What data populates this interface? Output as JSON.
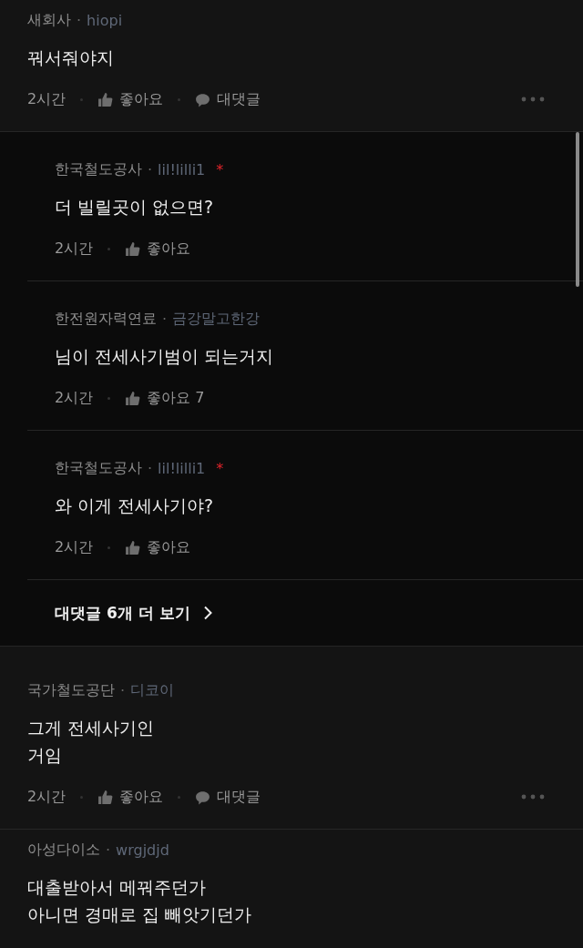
{
  "comments": [
    {
      "author": "새회사",
      "separator": "·",
      "handle": "hiopi",
      "body": "꿔서줘야지",
      "time": "2시간",
      "like_label": "좋아요",
      "reply_label": "대댓글",
      "replies": {
        "items": [
          {
            "author": "한국철도공사",
            "separator": "·",
            "handle": "lil!lilli1",
            "mark": "*",
            "body": "더 빌릴곳이 없으면?",
            "time": "2시간",
            "like_label": "좋아요"
          },
          {
            "author": "한전원자력연료",
            "separator": "·",
            "handle": "금강말고한강",
            "body": "님이 전세사기범이 되는거지",
            "time": "2시간",
            "like_label": "좋아요 7"
          },
          {
            "author": "한국철도공사",
            "separator": "·",
            "handle": "lil!lilli1",
            "mark": "*",
            "body": "와 이게 전세사기야?",
            "time": "2시간",
            "like_label": "좋아요"
          }
        ],
        "more_link": "대댓글 6개 더 보기"
      }
    },
    {
      "author": "국가철도공단",
      "separator": "·",
      "handle": "디코이",
      "body": "그게 전세사기인\n거임",
      "time": "2시간",
      "like_label": "좋아요",
      "reply_label": "대댓글"
    },
    {
      "author": "아성다이소",
      "separator": "·",
      "handle": "wrgjdjd",
      "body": "대출받아서 메꿔주던가\n아니면 경매로 집 빼앗기던가"
    }
  ]
}
